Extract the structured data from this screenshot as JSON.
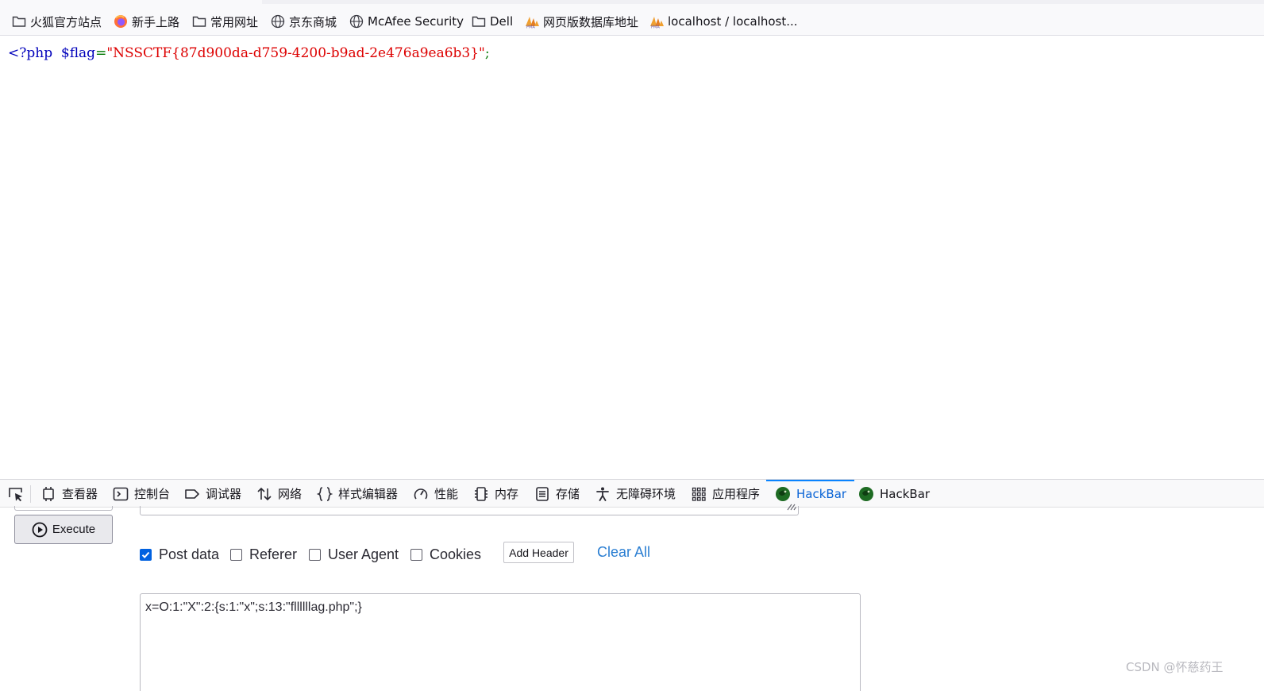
{
  "bookmarks": [
    {
      "label": "火狐官方站点",
      "icon": "folder-icon"
    },
    {
      "label": "新手上路",
      "icon": "firefox-icon"
    },
    {
      "label": "常用网址",
      "icon": "folder-icon"
    },
    {
      "label": "京东商城",
      "icon": "globe-icon"
    },
    {
      "label": "McAfee Security",
      "icon": "globe-icon"
    },
    {
      "label": "Dell",
      "icon": "folder-icon"
    },
    {
      "label": "网页版数据库地址",
      "icon": "phpmyadmin-icon"
    },
    {
      "label": "localhost / localhost...",
      "icon": "phpmyadmin-icon"
    }
  ],
  "page": {
    "php_open": "<?php",
    "var_name": "$flag",
    "equals": "=",
    "flag_value": "\"NSSCTF{87d900da-d759-4200-b9ad-2e476a9ea6b3}\"",
    "semicolon": ";"
  },
  "devtools": {
    "tabs": [
      {
        "label": "查看器",
        "icon": "inspector-icon"
      },
      {
        "label": "控制台",
        "icon": "console-icon"
      },
      {
        "label": "调试器",
        "icon": "debugger-icon"
      },
      {
        "label": "网络",
        "icon": "network-icon"
      },
      {
        "label": "样式编辑器",
        "icon": "style-editor-icon"
      },
      {
        "label": "性能",
        "icon": "performance-icon"
      },
      {
        "label": "内存",
        "icon": "memory-icon"
      },
      {
        "label": "存储",
        "icon": "storage-icon"
      },
      {
        "label": "无障碍环境",
        "icon": "accessibility-icon"
      },
      {
        "label": "应用程序",
        "icon": "application-icon"
      },
      {
        "label": "HackBar",
        "icon": "hackbar-icon",
        "active": true
      },
      {
        "label": "HackBar",
        "icon": "hackbar-icon",
        "active": false
      }
    ],
    "active_color": "#0a64d6"
  },
  "hackbar": {
    "execute_label": "Execute",
    "options": [
      {
        "label": "Post data",
        "checked": true
      },
      {
        "label": "Referer",
        "checked": false
      },
      {
        "label": "User Agent",
        "checked": false
      },
      {
        "label": "Cookies",
        "checked": false
      }
    ],
    "add_header_label": "Add Header",
    "clear_all_label": "Clear All",
    "post_body": "x=O:1:\"X\":2:{s:1:\"x\";s:13:\"fllllllag.php\";}"
  },
  "watermark": "CSDN @怀慈药王"
}
